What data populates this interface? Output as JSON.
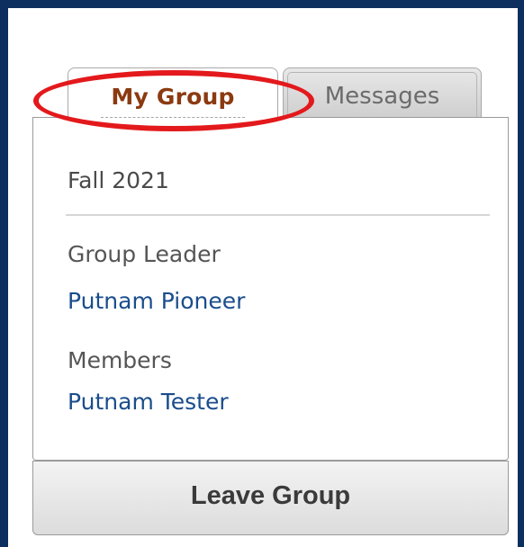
{
  "tabs": [
    {
      "label": "My Group",
      "active": true
    },
    {
      "label": "Messages",
      "active": false
    }
  ],
  "group": {
    "term": "Fall 2021",
    "leader_label": "Group Leader",
    "leader_name": "Putnam Pioneer",
    "members_label": "Members",
    "members": [
      "Putnam Tester"
    ]
  },
  "actions": {
    "leave_label": "Leave Group"
  },
  "colors": {
    "page_border": "#0c2f60",
    "highlight": "#e3191c",
    "active_tab_text": "#8b3a10",
    "link": "#1a4d8c"
  }
}
